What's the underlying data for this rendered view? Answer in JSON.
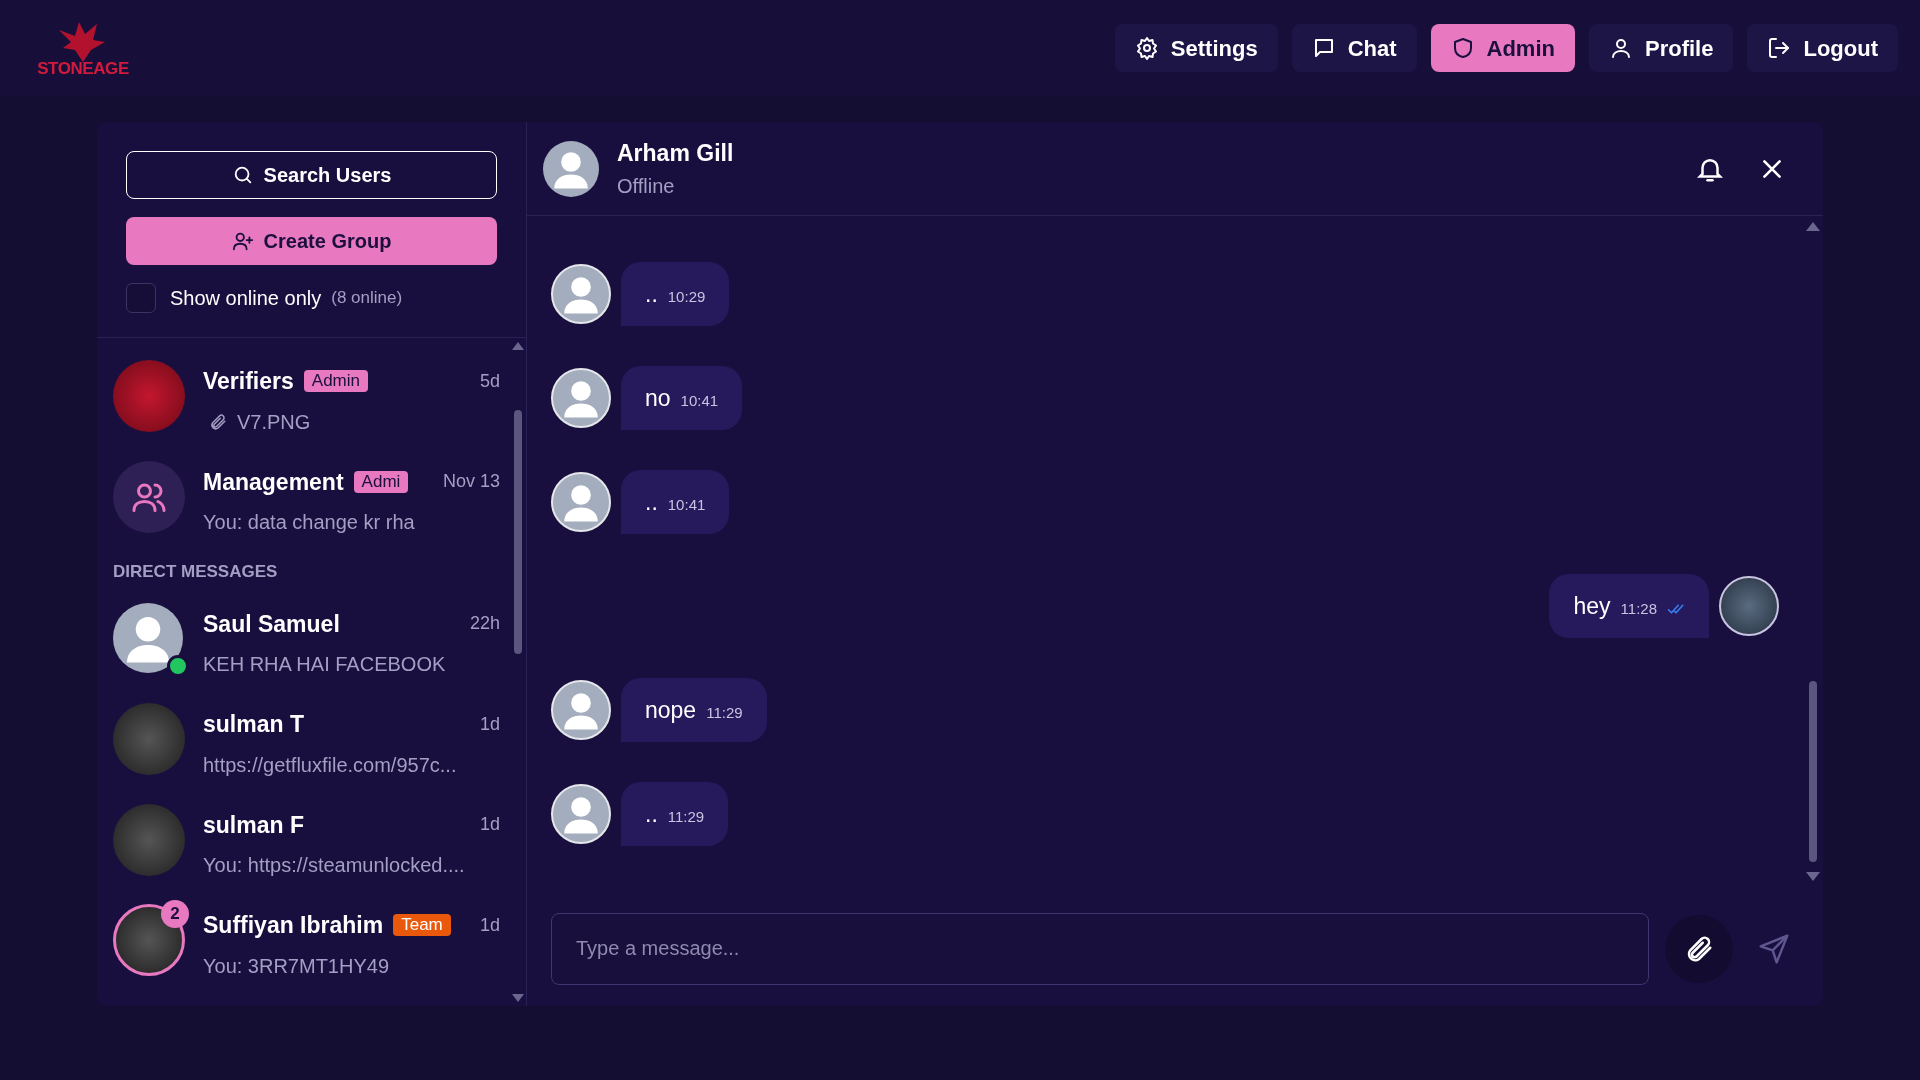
{
  "logo": {
    "text": "STONEAGE"
  },
  "nav": [
    {
      "label": "Settings",
      "selected": false
    },
    {
      "label": "Chat",
      "selected": false
    },
    {
      "label": "Admin",
      "selected": true
    },
    {
      "label": "Profile",
      "selected": false
    },
    {
      "label": "Logout",
      "selected": false
    }
  ],
  "sidebar": {
    "search_button": "Search Users",
    "create_button": "Create Group",
    "online_filter": {
      "label": "Show online only",
      "count": "(8 online)",
      "checked": false
    },
    "groups": [
      {
        "kind": "logo",
        "name": "Verifiers",
        "badge": "Admin",
        "color": "#e879c0",
        "time": "5d",
        "preview": "V7.PNG",
        "attachment": true
      },
      {
        "kind": "group",
        "name": "Management",
        "badge": "Admi",
        "color": "#e879c0",
        "time": "Nov 13",
        "preview": "You: data change kr rha",
        "attachment": false
      }
    ],
    "section_label": "DIRECT MESSAGES",
    "direct": [
      {
        "kind": "default",
        "name": "Saul Samuel",
        "time": "22h",
        "preview": "KEH RHA HAI FACEBOOK",
        "online": true
      },
      {
        "kind": "photo",
        "name": "sulman T",
        "time": "1d",
        "preview": "https://getfluxfile.com/957c...",
        "online": false
      },
      {
        "kind": "photo",
        "name": "sulman F",
        "time": "1d",
        "preview": "You: https://steamunlocked....",
        "online": false
      },
      {
        "kind": "photo",
        "name": "Suffiyan Ibrahim",
        "badge": "Team",
        "color": "#ea580c",
        "unread": "2",
        "time": "1d",
        "preview": "You: 3RR7MT1HY49",
        "online": false
      }
    ]
  },
  "chat": {
    "name": "Arham Gill",
    "status": "Offline",
    "messages": [
      {
        "kind": "received",
        "text": "..",
        "time": "10:29"
      },
      {
        "kind": "received",
        "text": "no",
        "time": "10:41"
      },
      {
        "kind": "received",
        "text": "..",
        "time": "10:41"
      },
      {
        "kind": "sent",
        "text": "hey",
        "time": "11:28",
        "read": true
      },
      {
        "kind": "received",
        "text": "nope",
        "time": "11:29"
      },
      {
        "kind": "received",
        "text": "..",
        "time": "11:29"
      }
    ],
    "input": {
      "placeholder": "Type a message..."
    }
  }
}
